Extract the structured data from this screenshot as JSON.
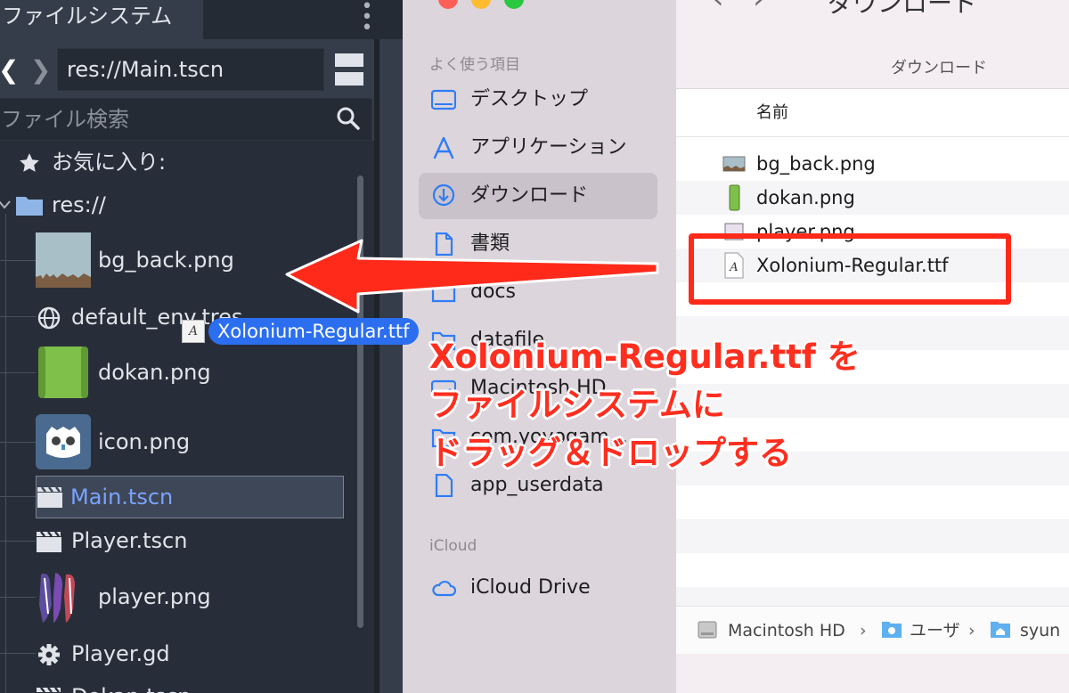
{
  "godot": {
    "tab_label": "ファイルシステム",
    "nav_back": "❮",
    "nav_forward": "❯",
    "path_value": "res://Main.tscn",
    "search_placeholder": "ファイル検索",
    "favorites_label": "お気に入り:",
    "root_label": "res://",
    "files": [
      {
        "name": "bg_back.png",
        "icon": "image-thumbnail"
      },
      {
        "name": "default_env.tres",
        "icon": "globe-icon"
      },
      {
        "name": "dokan.png",
        "icon": "image-thumbnail"
      },
      {
        "name": "icon.png",
        "icon": "godot-logo"
      },
      {
        "name": "Main.tscn",
        "icon": "scene-icon",
        "selected": true
      },
      {
        "name": "Player.tscn",
        "icon": "scene-icon"
      },
      {
        "name": "player.png",
        "icon": "image-thumbnail"
      },
      {
        "name": "Player.gd",
        "icon": "gear-icon"
      },
      {
        "name": "Dokan.tscn",
        "icon": "scene-icon"
      }
    ],
    "selected_color": "#7aa3ff"
  },
  "drag": {
    "label": "Xolonium-Regular.ttf",
    "icon_glyph": "A"
  },
  "finder": {
    "title": "ダウンロード",
    "subtitle": "ダウンロード",
    "nav_back": "‹",
    "nav_forward": "›",
    "sidebar": {
      "favorites_header": "よく使う項目",
      "favorites": [
        {
          "label": "デスクトップ",
          "icon": "desktop-icon"
        },
        {
          "label": "アプリケーション",
          "icon": "apps-icon"
        },
        {
          "label": "ダウンロード",
          "icon": "download-icon",
          "selected": true
        },
        {
          "label": "書類",
          "icon": "document-icon"
        },
        {
          "label": "docs",
          "icon": "folder-icon"
        },
        {
          "label": "datafile",
          "icon": "folder-icon"
        },
        {
          "label": "Macintosh HD",
          "icon": "disk-icon"
        },
        {
          "label": "com.yoyogam...",
          "icon": "folder-icon"
        },
        {
          "label": "app_userdata",
          "icon": "document-icon"
        }
      ],
      "icloud_header": "iCloud",
      "icloud": [
        {
          "label": "iCloud Drive",
          "icon": "cloud-icon"
        }
      ]
    },
    "column_name": "名前",
    "files": [
      {
        "name": "bg_back.png"
      },
      {
        "name": "dokan.png"
      },
      {
        "name": "player.png"
      },
      {
        "name": "Xolonium-Regular.ttf"
      }
    ],
    "path": [
      "Macintosh HD",
      "ユーザ",
      "syun"
    ]
  },
  "annotation": {
    "lines": [
      "Xolonium-Regular.ttf を",
      "ファイルシステムに",
      "ドラッグ＆ドロップする"
    ],
    "color": "#ff2e1f"
  }
}
